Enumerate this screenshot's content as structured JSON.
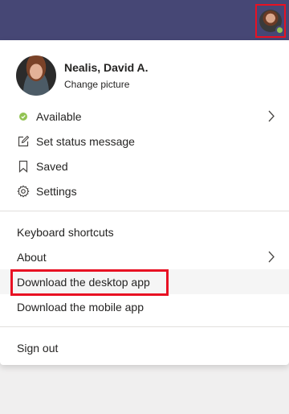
{
  "app": {
    "brand_color": "#464775",
    "highlight_color": "#e81123",
    "presence_color": "#92c353"
  },
  "profile": {
    "name": "Nealis, David A.",
    "change_picture": "Change picture"
  },
  "menu": {
    "status": {
      "label": "Available",
      "icon": "status-available-icon"
    },
    "set_status": {
      "label": "Set status message",
      "icon": "edit-icon"
    },
    "saved": {
      "label": "Saved",
      "icon": "bookmark-icon"
    },
    "settings": {
      "label": "Settings",
      "icon": "gear-icon"
    },
    "keyboard_shortcuts": {
      "label": "Keyboard shortcuts"
    },
    "about": {
      "label": "About"
    },
    "download_desktop": {
      "label": "Download the desktop app"
    },
    "download_mobile": {
      "label": "Download the mobile app"
    },
    "sign_out": {
      "label": "Sign out"
    }
  }
}
